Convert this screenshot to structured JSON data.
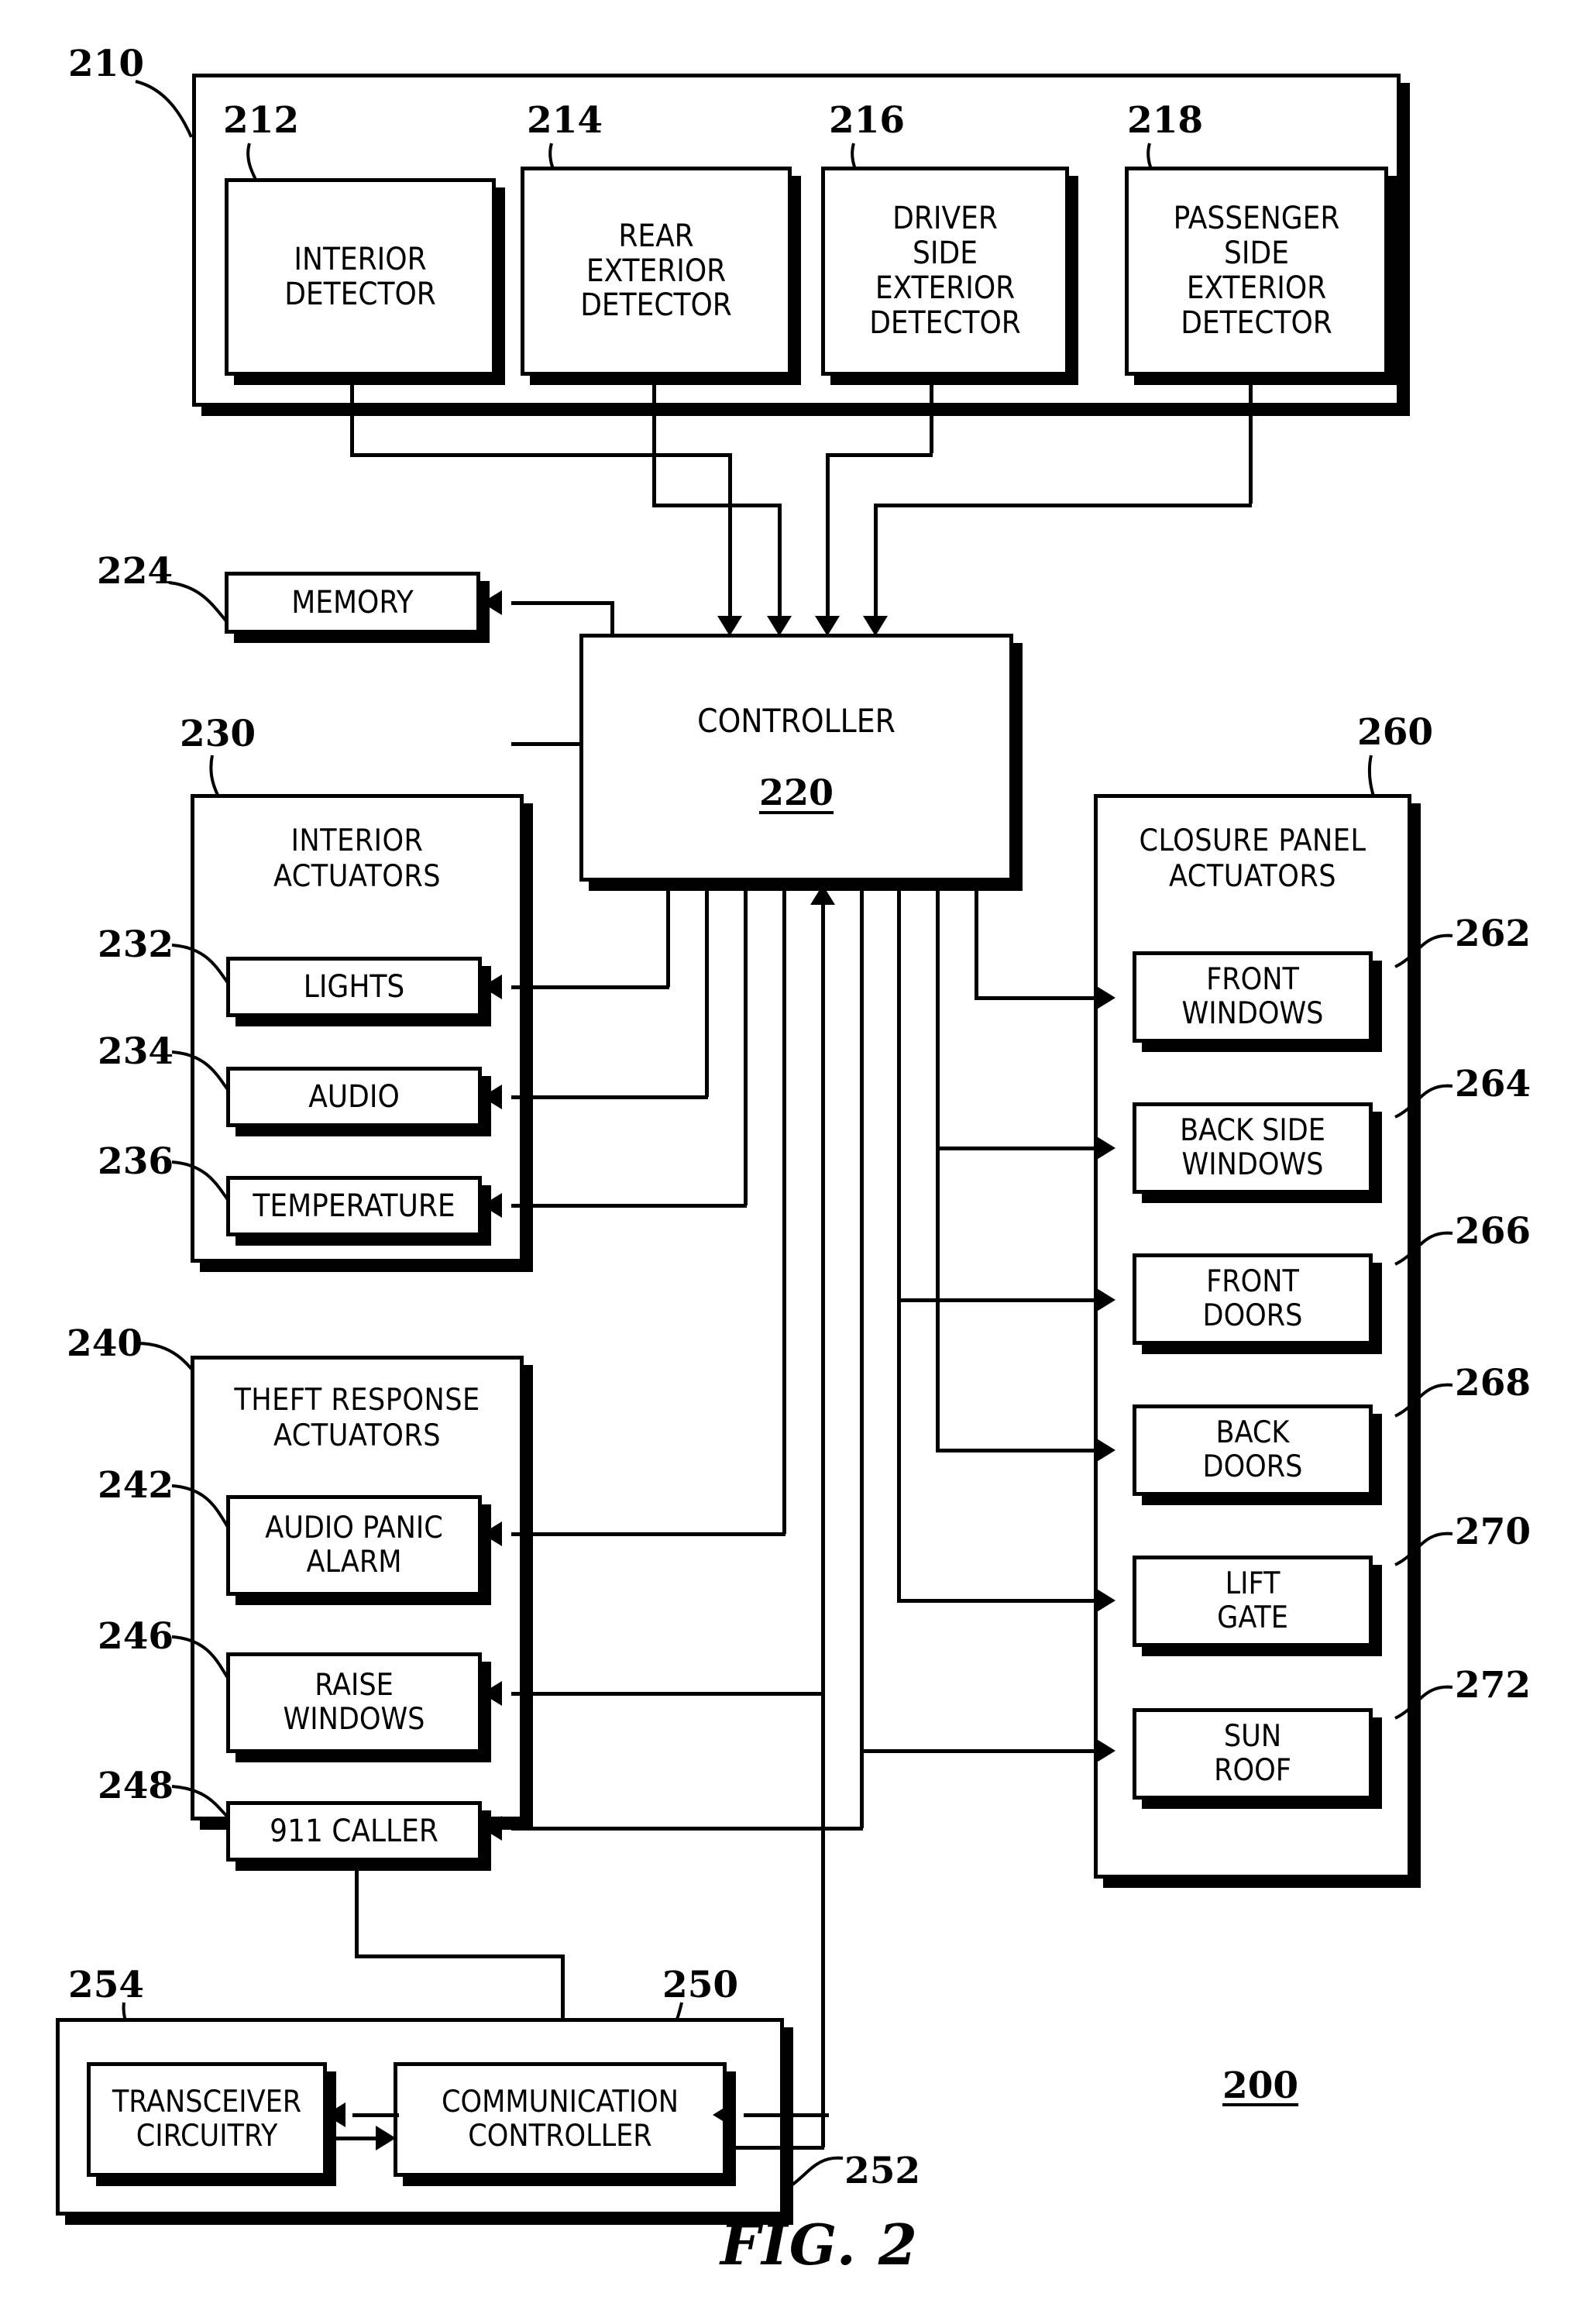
{
  "figure": {
    "caption": "FIG. 2",
    "system_ref": "200"
  },
  "detectors_group": {
    "ref": "210",
    "items": [
      {
        "ref": "212",
        "label": "INTERIOR\nDETECTOR"
      },
      {
        "ref": "214",
        "label": "REAR\nEXTERIOR\nDETECTOR"
      },
      {
        "ref": "216",
        "label": "DRIVER\nSIDE\nEXTERIOR\nDETECTOR"
      },
      {
        "ref": "218",
        "label": "PASSENGER\nSIDE\nEXTERIOR\nDETECTOR"
      }
    ]
  },
  "memory": {
    "ref": "224",
    "label": "MEMORY"
  },
  "controller": {
    "ref": "220",
    "label": "CONTROLLER"
  },
  "interior_actuators": {
    "ref": "230",
    "title": "INTERIOR\nACTUATORS",
    "items": [
      {
        "ref": "232",
        "label": "LIGHTS"
      },
      {
        "ref": "234",
        "label": "AUDIO"
      },
      {
        "ref": "236",
        "label": "TEMPERATURE"
      }
    ]
  },
  "theft_response_actuators": {
    "ref": "240",
    "title": "THEFT RESPONSE\nACTUATORS",
    "items": [
      {
        "ref": "242",
        "label": "AUDIO PANIC\nALARM"
      },
      {
        "ref": "246",
        "label": "RAISE\nWINDOWS"
      },
      {
        "ref": "248",
        "label": "911 CALLER"
      }
    ]
  },
  "closure_panel_actuators": {
    "ref": "260",
    "title": "CLOSURE PANEL\nACTUATORS",
    "items": [
      {
        "ref": "262",
        "label": "FRONT\nWINDOWS"
      },
      {
        "ref": "264",
        "label": "BACK SIDE\nWINDOWS"
      },
      {
        "ref": "266",
        "label": "FRONT\nDOORS"
      },
      {
        "ref": "268",
        "label": "BACK\nDOORS"
      },
      {
        "ref": "270",
        "label": "LIFT\nGATE"
      },
      {
        "ref": "272",
        "label": "SUN\nROOF"
      }
    ]
  },
  "communication_group": {
    "ref": "250",
    "bus_ref": "252",
    "items": [
      {
        "ref": "254",
        "label": "TRANSCEIVER\nCIRCUITRY"
      },
      {
        "ref": "250",
        "label": "COMMUNICATION\nCONTROLLER"
      }
    ]
  },
  "colors": {
    "stroke": "#000000",
    "background": "#ffffff"
  }
}
